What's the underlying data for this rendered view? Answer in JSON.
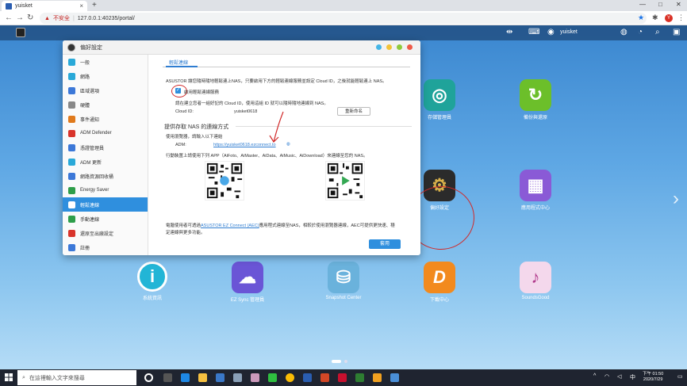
{
  "browser": {
    "tab_title": "yuisket",
    "url": "127.0.0.1:40235/portal/",
    "security_label": "不安全"
  },
  "adm": {
    "username": "yuisket"
  },
  "desktop_apps": [
    {
      "name": "app-storage-manager",
      "label": "存儲管理員",
      "color": "#1fa39a",
      "glyph": "◎"
    },
    {
      "name": "app-backup-restore",
      "label": "備份與還原",
      "color": "#6cbf2a",
      "glyph": "↻"
    },
    {
      "name": "app-settings",
      "label": "偏好設定",
      "color": "#2b2b2b",
      "glyph": "⚙"
    },
    {
      "name": "app-app-central",
      "label": "應用程式中心",
      "color": "#8a5ad6",
      "glyph": "▦"
    },
    {
      "name": "app-system-info",
      "label": "系統資訊",
      "color": "#22b5d6",
      "glyph": "i"
    },
    {
      "name": "app-ezsync",
      "label": "EZ Sync 管理員",
      "color": "#6a55d6",
      "glyph": "☁"
    },
    {
      "name": "app-snapshot",
      "label": "Snapshot Center",
      "color": "#6ab2dc",
      "glyph": "⛁"
    },
    {
      "name": "app-download",
      "label": "下載中心",
      "color": "#f28a1e",
      "glyph": "D"
    },
    {
      "name": "app-soundsgood",
      "label": "SoundsGood",
      "color": "#f4d8ec",
      "glyph": "♪"
    }
  ],
  "window": {
    "title": "偏好設定",
    "sidebar": [
      {
        "label": "一般",
        "color": "#2aa9d8"
      },
      {
        "label": "網路",
        "color": "#2aa9d8"
      },
      {
        "label": "區域選項",
        "color": "#3c78d8"
      },
      {
        "label": "硬體",
        "color": "#888888"
      },
      {
        "label": "事件通知",
        "color": "#e07a1c"
      },
      {
        "label": "ADM Defender",
        "color": "#d9342b"
      },
      {
        "label": "憑證管理員",
        "color": "#3c78d8"
      },
      {
        "label": "ADM 更新",
        "color": "#2aa9d8"
      },
      {
        "label": "網路資源回收桶",
        "color": "#3c78d8"
      },
      {
        "label": "Energy Saver",
        "color": "#2e9e4a"
      },
      {
        "label": "輕鬆連線",
        "color": "#ffffff"
      },
      {
        "label": "手動連線",
        "color": "#2e9e4a"
      },
      {
        "label": "還原至出廠設定",
        "color": "#d9342b"
      },
      {
        "label": "註冊",
        "color": "#3c78d8"
      }
    ],
    "active_index": 10,
    "tab": "輕鬆連線",
    "intro": "ASUSTOR 讓您隨時隨地輕鬆連上NAS，只要啟用下方的輕鬆連線服務並設定 Cloud ID，之後就能輕鬆連上 NAS。",
    "enable_label": "啟用輕鬆連線服務",
    "cloudid_hint": "請在建立您者一組好記的 Cloud ID，使用這組 ID 就可以隨時隨地連線到 NAS。",
    "cloudid_label": "Cloud ID:",
    "cloudid_value": "yuisket0618",
    "change_btn": "重新命名",
    "section_title": "提供存取 NAS 的連線方式",
    "browser_hint": "使用瀏覽器，請輸入以下連結",
    "adm_label": "ADM:",
    "adm_link": "https://yuisket0618.ezconnect.to",
    "mobile_hint": "行動裝置上請使用下列 APP（AiFoto、AiMaster、AiData、AiMusic、AiDownload）來連線至您的 NAS。",
    "pc_hint_1": "電腦使用者可透過",
    "pc_link": "ASUSTOR EZ Connect (AEC)",
    "pc_hint_2": "應用程式連線至NAS，相較於使用瀏覽器連線，AEC可提供更快速、穩",
    "pc_hint_3": "定連線與更多功能。",
    "apply_btn": "套用"
  },
  "taskbar": {
    "search_placeholder": "在這裡輸入文字來搜尋",
    "time": "下午 01:50",
    "date": "2020/7/29"
  }
}
